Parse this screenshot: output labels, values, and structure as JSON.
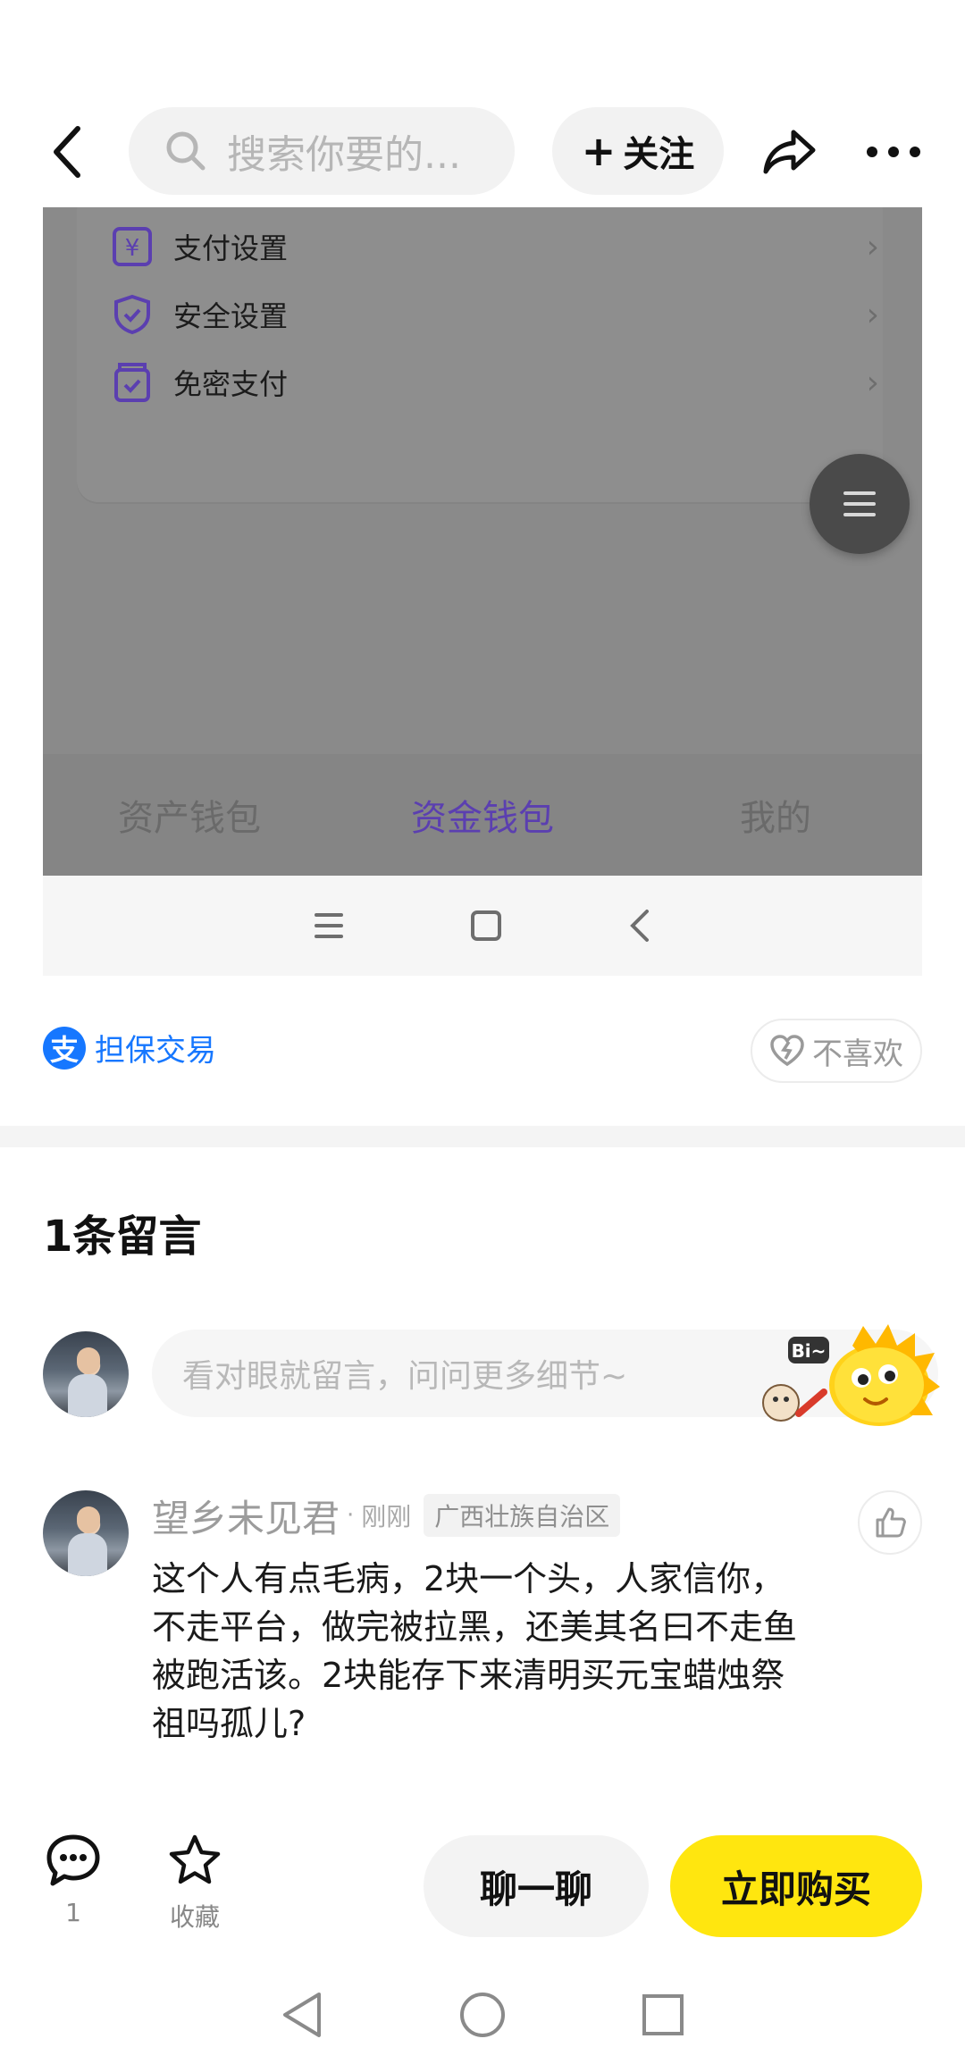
{
  "header": {
    "search_placeholder": "搜索你要的...",
    "follow_label": "关注"
  },
  "embedded_screenshot": {
    "menu_items": [
      {
        "label": "支付设置",
        "icon": "yuan-card-icon"
      },
      {
        "label": "安全设置",
        "icon": "shield-check-icon"
      },
      {
        "label": "免密支付",
        "icon": "wallet-check-icon"
      }
    ],
    "tabs": [
      {
        "label": "资产钱包",
        "active": false
      },
      {
        "label": "资金钱包",
        "active": true
      },
      {
        "label": "我的",
        "active": false
      }
    ],
    "accent_color": "#5b3fb0"
  },
  "trade": {
    "guarantee_label": "担保交易",
    "alipay_glyph": "支",
    "dislike_label": "不喜欢"
  },
  "comments": {
    "title": "1条留言",
    "input_placeholder": "看对眼就留言，问问更多细节~",
    "items": [
      {
        "author": "望乡未见君",
        "time": "刚刚",
        "region": "广西壮族自治区",
        "text": "这个人有点毛病，2块一个头，人家信你，不走平台，做完被拉黑，还美其名曰不走鱼被跑活该。2块能存下来清明买元宝蜡烛祭祖吗孤儿?"
      }
    ]
  },
  "bottom_bar": {
    "comment_count": "1",
    "favorite_label": "收藏",
    "chat_label": "聊一聊",
    "buy_label": "立即购买",
    "buy_color": "#ffe60f"
  }
}
